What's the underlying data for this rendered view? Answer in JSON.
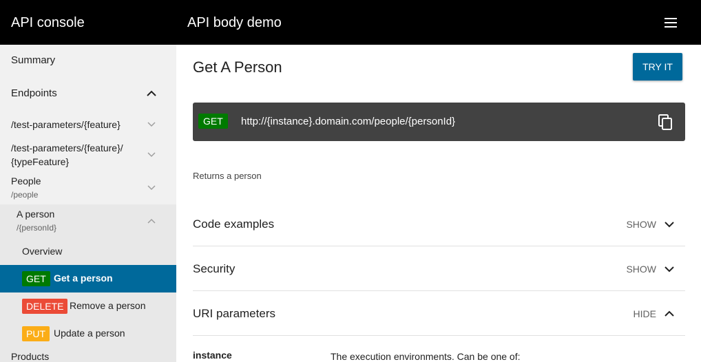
{
  "header": {
    "app_title": "API console",
    "api_title": "API body demo",
    "menu_icon": "hamburger-menu-icon"
  },
  "sidebar": {
    "summary": "Summary",
    "endpoints": "Endpoints",
    "items": [
      {
        "path": "/test-parameters/{feature}"
      },
      {
        "path_line1": "/test-parameters/{feature}/",
        "path_line2": "{typeFeature}"
      },
      {
        "name": "People",
        "path": "/people"
      },
      {
        "name": "A person",
        "path": "/{personId}"
      }
    ],
    "overview": "Overview",
    "operations": [
      {
        "method": "GET",
        "label": "Get a person",
        "selected": true
      },
      {
        "method": "DELETE",
        "label": "Remove a person",
        "selected": false
      },
      {
        "method": "PUT",
        "label": "Update a person",
        "selected": false
      }
    ],
    "products": "Products"
  },
  "main": {
    "title": "Get A Person",
    "try_label": "TRY IT",
    "method": "GET",
    "url": "http://{instance}.domain.com/people/{personId}",
    "description": "Returns a person",
    "sections": [
      {
        "title": "Code examples",
        "toggle": "SHOW"
      },
      {
        "title": "Security",
        "toggle": "SHOW"
      },
      {
        "title": "URI parameters",
        "toggle": "HIDE"
      }
    ],
    "param": {
      "name": "instance",
      "description": "The execution environments. Can be one of:"
    }
  },
  "colors": {
    "header_bg": "#000000",
    "accent": "#00699b",
    "get": "#007a00",
    "delete": "#eb4b37",
    "put": "#fbad17"
  }
}
